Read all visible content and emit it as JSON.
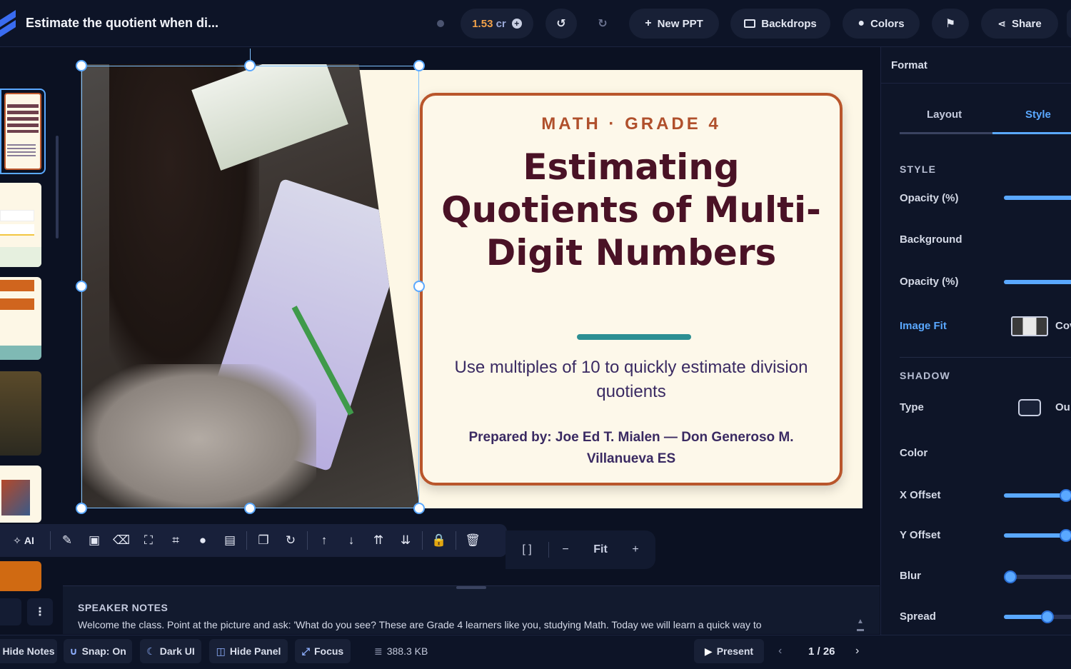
{
  "header": {
    "title": "Estimate the quotient when di...",
    "credits_value": "1.53",
    "credits_unit": "cr",
    "new_ppt_label": "New PPT",
    "backdrops_label": "Backdrops",
    "colors_label": "Colors",
    "share_label": "Share"
  },
  "slide": {
    "eyebrow": "MATH · GRADE 4",
    "title": "Estimating Quotients of Multi-Digit Numbers",
    "subtitle": "Use multiples of 10 to quickly estimate division quotients",
    "author": "Prepared by: Joe Ed T. Mialen — Don Generoso M. Villanueva ES"
  },
  "colors": {
    "accent": "#5aa8ff",
    "card_border": "#b9562c",
    "title_text": "#4a1226",
    "rule": "#2c8f93"
  },
  "toolbar": {
    "ai_label": "AI",
    "icons": [
      "magic-wand-icon",
      "image-icon",
      "eraser-icon",
      "expand-icon",
      "crop-icon",
      "drop-icon",
      "caption-icon",
      "duplicate-icon",
      "rotate-icon",
      "arrow-up-icon",
      "arrow-down-icon",
      "bring-front-icon",
      "send-back-icon",
      "lock-icon",
      "trash-icon"
    ]
  },
  "zoom": {
    "brackets": "[ ]",
    "minus": "−",
    "fit_label": "Fit",
    "plus": "+"
  },
  "notes": {
    "label": "SPEAKER NOTES",
    "text": "Welcome the class. Point at the picture and ask: 'What do you see? These are Grade 4 learners like you, studying Math. Today we will learn a quick way to"
  },
  "status": {
    "hide_notes": "Hide Notes",
    "snap": "Snap: On",
    "theme": "Dark UI",
    "hide_panel": "Hide Panel",
    "focus": "Focus",
    "size": "388.3 KB",
    "present": "Present",
    "page": "1 / 26"
  },
  "panel": {
    "title": "Format",
    "tab_layout": "Layout",
    "tab_style": "Style",
    "style_section": "STYLE",
    "opacity_label": "Opacity (%)",
    "background_label": "Background",
    "bg_opacity_label": "Opacity (%)",
    "image_fit_label": "Image Fit",
    "image_fit_value": "Cov",
    "shadow_section": "SHADOW",
    "type_label": "Type",
    "type_value": "Ou",
    "color_label": "Color",
    "x_offset_label": "X Offset",
    "y_offset_label": "Y Offset",
    "blur_label": "Blur",
    "spread_label": "Spread"
  }
}
